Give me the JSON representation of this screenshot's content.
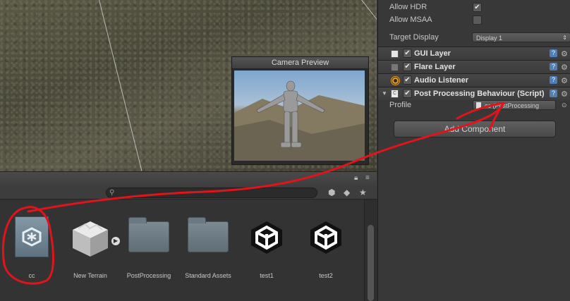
{
  "scene": {
    "camera_preview": {
      "title": "Camera Preview"
    }
  },
  "project": {
    "search": {
      "placeholder": ""
    },
    "assets": [
      {
        "label": "cc",
        "icon": "unity-logo-icon",
        "selected": true
      },
      {
        "label": "New Terrain",
        "icon": "terrain-cube-icon"
      },
      {
        "label": "PostProcessing",
        "icon": "folder-icon"
      },
      {
        "label": "Standard Assets",
        "icon": "folder-icon"
      },
      {
        "label": "test1",
        "icon": "unity-scene-icon"
      },
      {
        "label": "test2",
        "icon": "unity-scene-icon"
      }
    ]
  },
  "inspector": {
    "allow_hdr": {
      "label": "Allow HDR",
      "checked": true
    },
    "allow_msaa": {
      "label": "Allow MSAA",
      "checked": false
    },
    "target_display": {
      "label": "Target Display",
      "value": "Display 1"
    },
    "components": [
      {
        "name": "GUI Layer",
        "icon": "gui-layer-icon",
        "enabled": true
      },
      {
        "name": "Flare Layer",
        "icon": "flare-layer-icon",
        "enabled": true
      },
      {
        "name": "Audio Listener",
        "icon": "audio-listener-icon",
        "enabled": true
      },
      {
        "name": "Post Processing Behaviour (Script)",
        "icon": "script-icon",
        "enabled": true
      }
    ],
    "profile": {
      "label": "Profile",
      "value": "cc (PostProcessing"
    },
    "add_component_label": "Add Component"
  },
  "colors": {
    "annotation": "#e0141a",
    "panel": "#383838",
    "help": "#4f7fb9"
  }
}
